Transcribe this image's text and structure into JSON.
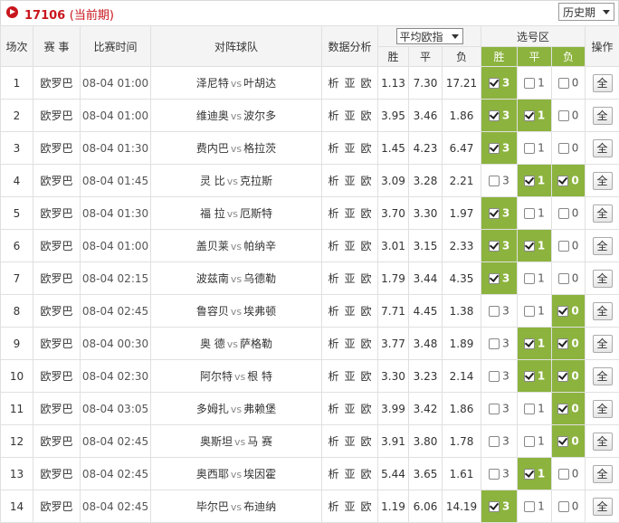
{
  "header": {
    "issue_no": "17106",
    "issue_status": "(当前期)",
    "history_select": "历史期"
  },
  "columns": {
    "idx": "场次",
    "league": "赛 事",
    "time": "比赛时间",
    "teams": "对阵球队",
    "analysis": "数据分析",
    "avg_select": "平均欧指",
    "win": "胜",
    "draw": "平",
    "lose": "负",
    "select_zone": "选号区",
    "sel_win": "胜",
    "sel_draw": "平",
    "sel_lose": "负",
    "op": "操作"
  },
  "analysis_links": [
    "析",
    "亚",
    "欧"
  ],
  "all_button": "全",
  "sel_values": [
    "3",
    "1",
    "0"
  ],
  "colors": {
    "selected": "#8cb33e",
    "issue_red": "#c8161d"
  },
  "rows": [
    {
      "idx": "1",
      "league": "欧罗巴",
      "time": "08-04 01:00",
      "home": "泽尼特",
      "away": "叶胡达",
      "w": "1.13",
      "d": "7.30",
      "l": "17.21",
      "sel": [
        true,
        false,
        false
      ]
    },
    {
      "idx": "2",
      "league": "欧罗巴",
      "time": "08-04 01:00",
      "home": "维迪奥",
      "away": "波尔多",
      "w": "3.95",
      "d": "3.46",
      "l": "1.86",
      "sel": [
        true,
        true,
        false
      ]
    },
    {
      "idx": "3",
      "league": "欧罗巴",
      "time": "08-04 01:30",
      "home": "费内巴",
      "away": "格拉茨",
      "w": "1.45",
      "d": "4.23",
      "l": "6.47",
      "sel": [
        true,
        false,
        false
      ]
    },
    {
      "idx": "4",
      "league": "欧罗巴",
      "time": "08-04 01:45",
      "home": "灵 比",
      "away": "克拉斯",
      "w": "3.09",
      "d": "3.28",
      "l": "2.21",
      "sel": [
        false,
        true,
        true
      ]
    },
    {
      "idx": "5",
      "league": "欧罗巴",
      "time": "08-04 01:30",
      "home": "福 拉",
      "away": "厄斯特",
      "w": "3.70",
      "d": "3.30",
      "l": "1.97",
      "sel": [
        true,
        false,
        false
      ]
    },
    {
      "idx": "6",
      "league": "欧罗巴",
      "time": "08-04 01:00",
      "home": "盖贝莱",
      "away": "帕纳辛",
      "w": "3.01",
      "d": "3.15",
      "l": "2.33",
      "sel": [
        true,
        true,
        false
      ]
    },
    {
      "idx": "7",
      "league": "欧罗巴",
      "time": "08-04 02:15",
      "home": "波兹南",
      "away": "乌德勒",
      "w": "1.79",
      "d": "3.44",
      "l": "4.35",
      "sel": [
        true,
        false,
        false
      ]
    },
    {
      "idx": "8",
      "league": "欧罗巴",
      "time": "08-04 02:45",
      "home": "鲁容贝",
      "away": "埃弗顿",
      "w": "7.71",
      "d": "4.45",
      "l": "1.38",
      "sel": [
        false,
        false,
        true
      ]
    },
    {
      "idx": "9",
      "league": "欧罗巴",
      "time": "08-04 00:30",
      "home": "奥 德",
      "away": "萨格勒",
      "w": "3.77",
      "d": "3.48",
      "l": "1.89",
      "sel": [
        false,
        true,
        true
      ]
    },
    {
      "idx": "10",
      "league": "欧罗巴",
      "time": "08-04 02:30",
      "home": "阿尔特",
      "away": "根 特",
      "w": "3.30",
      "d": "3.23",
      "l": "2.14",
      "sel": [
        false,
        true,
        true
      ]
    },
    {
      "idx": "11",
      "league": "欧罗巴",
      "time": "08-04 03:05",
      "home": "多姆扎",
      "away": "弗赖堡",
      "w": "3.99",
      "d": "3.42",
      "l": "1.86",
      "sel": [
        false,
        false,
        true
      ]
    },
    {
      "idx": "12",
      "league": "欧罗巴",
      "time": "08-04 02:45",
      "home": "奥斯坦",
      "away": "马 赛",
      "w": "3.91",
      "d": "3.80",
      "l": "1.78",
      "sel": [
        false,
        false,
        true
      ]
    },
    {
      "idx": "13",
      "league": "欧罗巴",
      "time": "08-04 02:45",
      "home": "奥西耶",
      "away": "埃因霍",
      "w": "5.44",
      "d": "3.65",
      "l": "1.61",
      "sel": [
        false,
        true,
        false
      ]
    },
    {
      "idx": "14",
      "league": "欧罗巴",
      "time": "08-04 02:45",
      "home": "毕尔巴",
      "away": "布迪纳",
      "w": "1.19",
      "d": "6.06",
      "l": "14.19",
      "sel": [
        true,
        false,
        false
      ]
    }
  ]
}
